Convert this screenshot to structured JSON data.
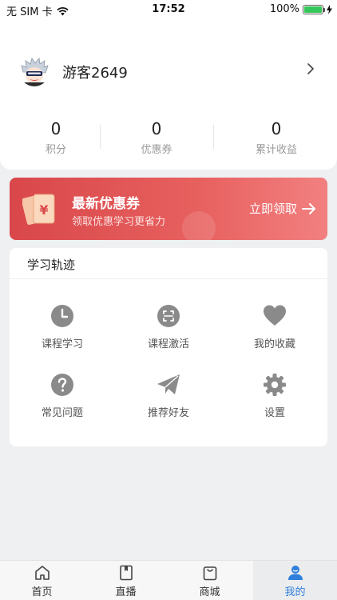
{
  "status_bar": {
    "carrier": "无 SIM 卡",
    "time": "17:52",
    "battery_text": "100%",
    "battery_level": 1.0
  },
  "profile": {
    "username": "游客2649",
    "stats": [
      {
        "value": "0",
        "label": "积分"
      },
      {
        "value": "0",
        "label": "优惠券"
      },
      {
        "value": "0",
        "label": "累计收益"
      }
    ]
  },
  "coupon_banner": {
    "title": "最新优惠券",
    "subtitle": "领取优惠学习更省力",
    "cta": "立即领取",
    "icon": "coupon-icon"
  },
  "learning_tracks": {
    "title": "学习轨迹",
    "items": [
      {
        "label": "课程学习",
        "icon": "clock-icon"
      },
      {
        "label": "课程激活",
        "icon": "scan-icon"
      },
      {
        "label": "我的收藏",
        "icon": "heart-icon"
      },
      {
        "label": "常见问题",
        "icon": "question-icon"
      },
      {
        "label": "推荐好友",
        "icon": "send-icon"
      },
      {
        "label": "设置",
        "icon": "gear-icon"
      }
    ]
  },
  "tab_bar": {
    "tabs": [
      {
        "label": "首页",
        "icon": "home-icon",
        "active": false
      },
      {
        "label": "直播",
        "icon": "book-icon",
        "active": false
      },
      {
        "label": "商城",
        "icon": "shopping-bag-icon",
        "active": false
      },
      {
        "label": "我的",
        "icon": "user-icon",
        "active": true
      }
    ]
  },
  "colors": {
    "accent": "#2f7fdc",
    "banner_start": "#d9474a",
    "banner_end": "#f28080",
    "icon_gray": "#8a8a8a"
  }
}
